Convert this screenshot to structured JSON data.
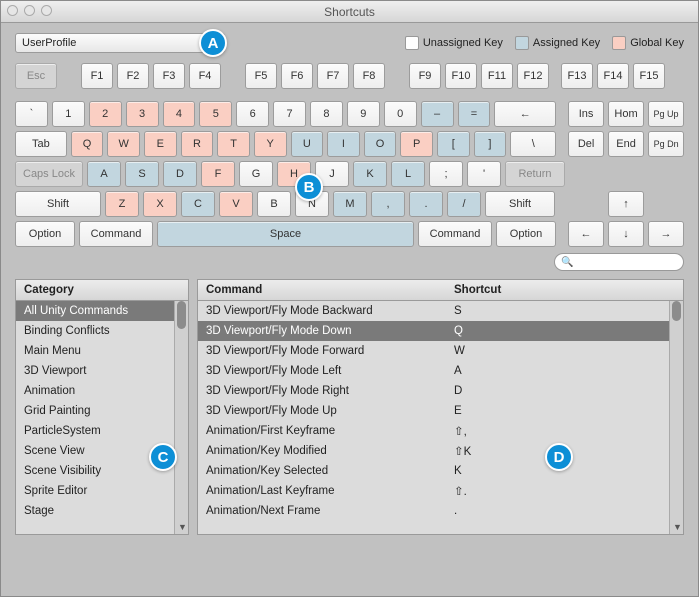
{
  "window": {
    "title": "Shortcuts"
  },
  "profile": {
    "label": "UserProfile"
  },
  "legend": {
    "unassigned": "Unassigned Key",
    "assigned": "Assigned Key",
    "global": "Global Key"
  },
  "callouts": {
    "a": "A",
    "b": "B",
    "c": "C",
    "d": "D"
  },
  "keys": {
    "esc": "Esc",
    "f1": "F1",
    "f2": "F2",
    "f3": "F3",
    "f4": "F4",
    "f5": "F5",
    "f6": "F6",
    "f7": "F7",
    "f8": "F8",
    "f9": "F9",
    "f10": "F10",
    "f11": "F11",
    "f12": "F12",
    "f13": "F13",
    "f14": "F14",
    "f15": "F15",
    "backtick": "`",
    "n1": "1",
    "n2": "2",
    "n3": "3",
    "n4": "4",
    "n5": "5",
    "n6": "6",
    "n7": "7",
    "n8": "8",
    "n9": "9",
    "n0": "0",
    "minus": "–",
    "equal": "=",
    "back": "←",
    "ins": "Ins",
    "home": "Hom",
    "pgup": "Pg Up",
    "del": "Del",
    "end": "End",
    "pgdn": "Pg Dn",
    "tab": "Tab",
    "q": "Q",
    "w": "W",
    "e": "E",
    "r": "R",
    "t": "T",
    "y": "Y",
    "u": "U",
    "i": "I",
    "o": "O",
    "p": "P",
    "lbr": "[",
    "rbr": "]",
    "bslash": "\\",
    "caps": "Caps Lock",
    "a": "A",
    "s": "S",
    "d": "D",
    "f": "F",
    "g": "G",
    "h": "H",
    "j": "J",
    "k": "K",
    "l": "L",
    "semi": ";",
    "apos": "'",
    "ret": "Return",
    "shiftL": "Shift",
    "z": "Z",
    "x": "X",
    "c": "C",
    "v": "V",
    "b": "B",
    "n": "N",
    "m": "M",
    "comma": ",",
    "period": ".",
    "slash": "/",
    "shiftR": "Shift",
    "optL": "Option",
    "cmdL": "Command",
    "space": "Space",
    "cmdR": "Command",
    "optR": "Option",
    "up": "↑",
    "left": "←",
    "down": "↓",
    "right": "→"
  },
  "headers": {
    "category": "Category",
    "command": "Command",
    "shortcut": "Shortcut"
  },
  "categories": [
    {
      "label": "All Unity Commands",
      "selected": true
    },
    {
      "label": "Binding Conflicts"
    },
    {
      "label": "Main Menu"
    },
    {
      "label": "3D Viewport"
    },
    {
      "label": "Animation"
    },
    {
      "label": "Grid Painting"
    },
    {
      "label": "ParticleSystem"
    },
    {
      "label": "Scene View"
    },
    {
      "label": "Scene Visibility"
    },
    {
      "label": "Sprite Editor"
    },
    {
      "label": "Stage"
    }
  ],
  "commands": [
    {
      "cmd": "3D Viewport/Fly Mode Backward",
      "sc": "S"
    },
    {
      "cmd": "3D Viewport/Fly Mode Down",
      "sc": "Q",
      "selected": true
    },
    {
      "cmd": "3D Viewport/Fly Mode Forward",
      "sc": "W"
    },
    {
      "cmd": "3D Viewport/Fly Mode Left",
      "sc": "A"
    },
    {
      "cmd": "3D Viewport/Fly Mode Right",
      "sc": "D"
    },
    {
      "cmd": "3D Viewport/Fly Mode Up",
      "sc": "E"
    },
    {
      "cmd": "Animation/First Keyframe",
      "sc": "⇧,"
    },
    {
      "cmd": "Animation/Key Modified",
      "sc": "⇧K"
    },
    {
      "cmd": "Animation/Key Selected",
      "sc": "K"
    },
    {
      "cmd": "Animation/Last Keyframe",
      "sc": "⇧."
    },
    {
      "cmd": "Animation/Next Frame",
      "sc": "."
    }
  ],
  "search": {
    "placeholder": ""
  }
}
